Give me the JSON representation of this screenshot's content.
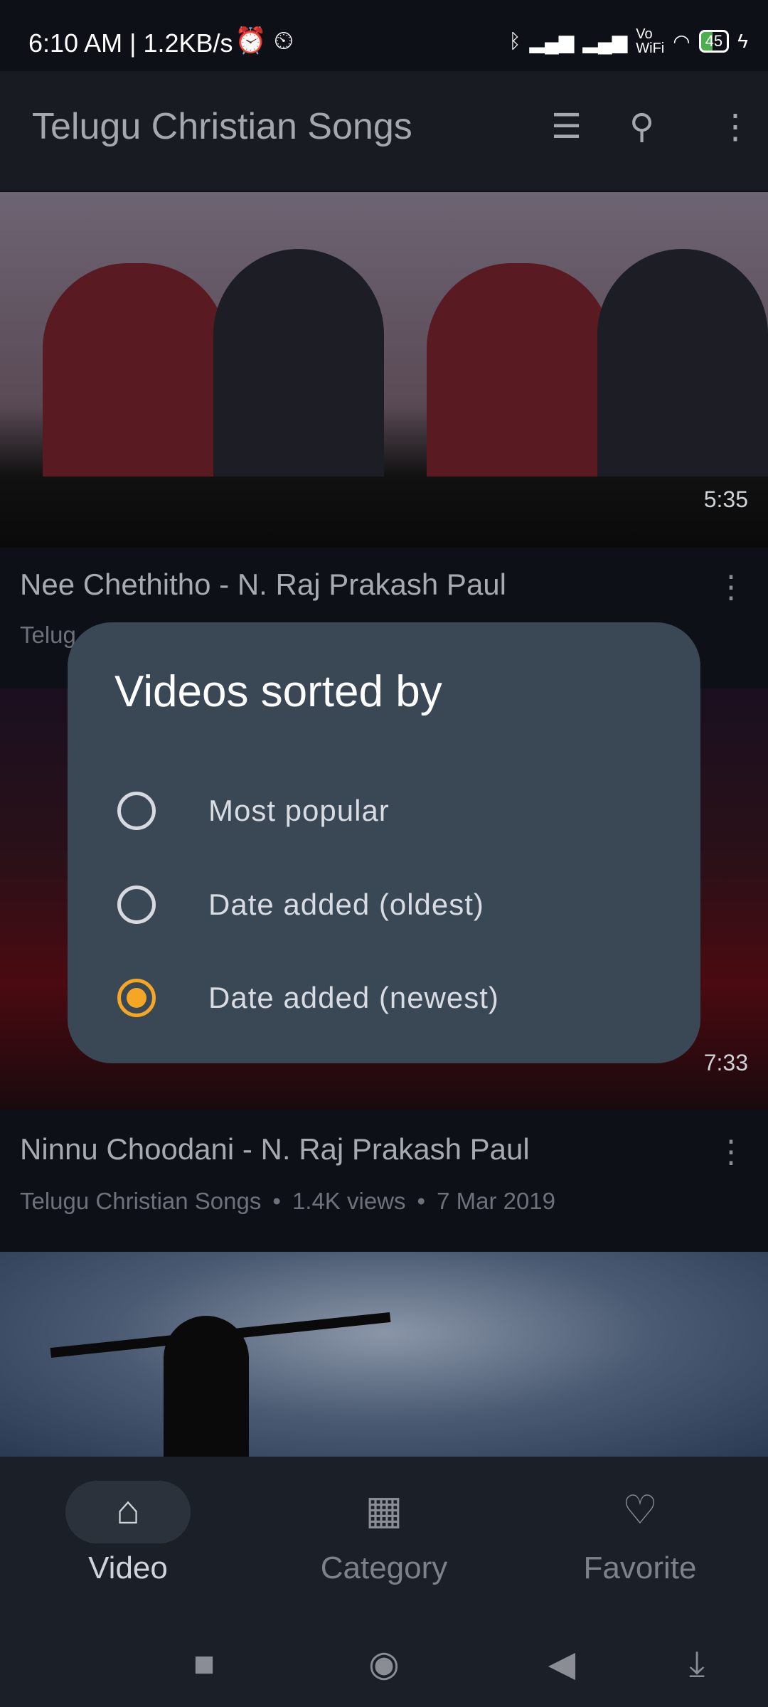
{
  "status_bar": {
    "time": "6:10 AM | 1.2KB/s",
    "network": "Vo WiFi",
    "battery": "45"
  },
  "app_bar": {
    "title": "Telugu Christian Songs",
    "icons": [
      "sort-icon",
      "search-icon",
      "more-vert-icon"
    ]
  },
  "videos": [
    {
      "title": "Nee Chethitho - N. Raj Prakash Paul",
      "channel": "Telug",
      "views": "",
      "date": "",
      "duration": "5:35"
    },
    {
      "title": "Ninnu Choodani - N. Raj Prakash Paul",
      "channel": "Telugu Christian Songs",
      "views": "1.4K views",
      "date": "7 Mar 2019",
      "duration": "7:33"
    },
    {
      "title": "",
      "duration": ""
    }
  ],
  "dialog": {
    "title": "Videos sorted by",
    "options": [
      {
        "label": "Most popular",
        "selected": false
      },
      {
        "label": "Date added (oldest)",
        "selected": false
      },
      {
        "label": "Date added (newest)",
        "selected": true
      }
    ],
    "accent": "#f5a623"
  },
  "bottom_nav": [
    {
      "label": "Video",
      "icon": "home-icon",
      "active": true
    },
    {
      "label": "Category",
      "icon": "grid-icon",
      "active": false
    },
    {
      "label": "Favorite",
      "icon": "heart-icon",
      "active": false
    }
  ],
  "sep": "•"
}
